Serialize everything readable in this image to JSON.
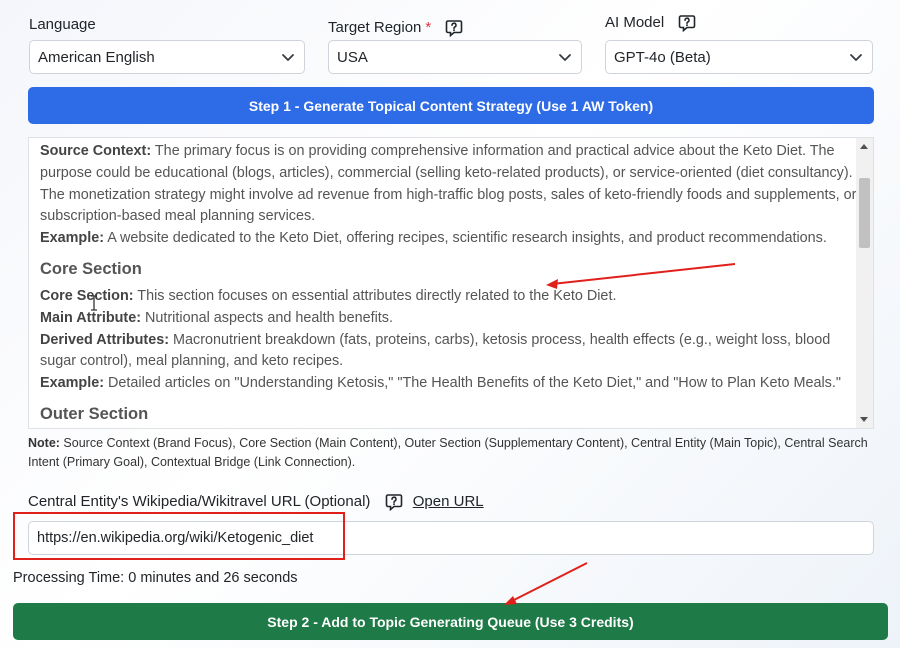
{
  "fields": {
    "language": {
      "label": "Language",
      "value": "American English"
    },
    "target_region": {
      "label": "Target Region",
      "required_mark": "*",
      "value": "USA"
    },
    "ai_model": {
      "label": "AI Model",
      "value": "GPT-4o (Beta)"
    }
  },
  "step1_button": "Step 1 - Generate Topical Content Strategy (Use 1 AW Token)",
  "output": {
    "source_context_label": "Source Context:",
    "source_context_text": " The primary focus is on providing comprehensive information and practical advice about the Keto Diet. The purpose could be educational (blogs, articles), commercial (selling keto-related products), or service-oriented (diet consultancy). The monetization strategy might involve ad revenue from high-traffic blog posts, sales of keto-friendly foods and supplements, or subscription-based meal planning services.",
    "example1_label": "Example:",
    "example1_text": " A website dedicated to the Keto Diet, offering recipes, scientific research insights, and product recommendations.",
    "core_heading": "Core Section",
    "core_label": "Core Section:",
    "core_text": " This section focuses on essential attributes directly related to the Keto Diet.",
    "main_attr_label": "Main Attribute:",
    "main_attr_text": " Nutritional aspects and health benefits.",
    "derived_label": "Derived Attributes:",
    "derived_text": " Macronutrient breakdown (fats, proteins, carbs), ketosis process, health effects (e.g., weight loss, blood sugar control), meal planning, and keto recipes.",
    "example2_label": "Example:",
    "example2_text": " Detailed articles on \"Understanding Ketosis,\" \"The Health Benefits of the Keto Diet,\" and \"How to Plan Keto Meals.\"",
    "outer_heading": "Outer Section"
  },
  "note": {
    "label": "Note:",
    "text": " Source Context (Brand Focus), Core Section (Main Content), Outer Section (Supplementary Content), Central Entity (Main Topic), Central Search Intent (Primary Goal), Contextual Bridge (Link Connection)."
  },
  "wiki": {
    "label": "Central Entity's Wikipedia/Wikitravel URL (Optional)",
    "open_url": "Open URL",
    "value": "https://en.wikipedia.org/wiki/Ketogenic_diet"
  },
  "processing_time": "Processing Time: 0 minutes and 26 seconds",
  "step2_button": "Step 2 - Add to Topic Generating Queue (Use 3 Credits)",
  "colors": {
    "primary": "#2e6be6",
    "success": "#1e7a46",
    "annotation": "#e0201b"
  },
  "icons": [
    "help-icon",
    "chevron-down-icon",
    "text-cursor-icon",
    "annotation-arrow"
  ]
}
